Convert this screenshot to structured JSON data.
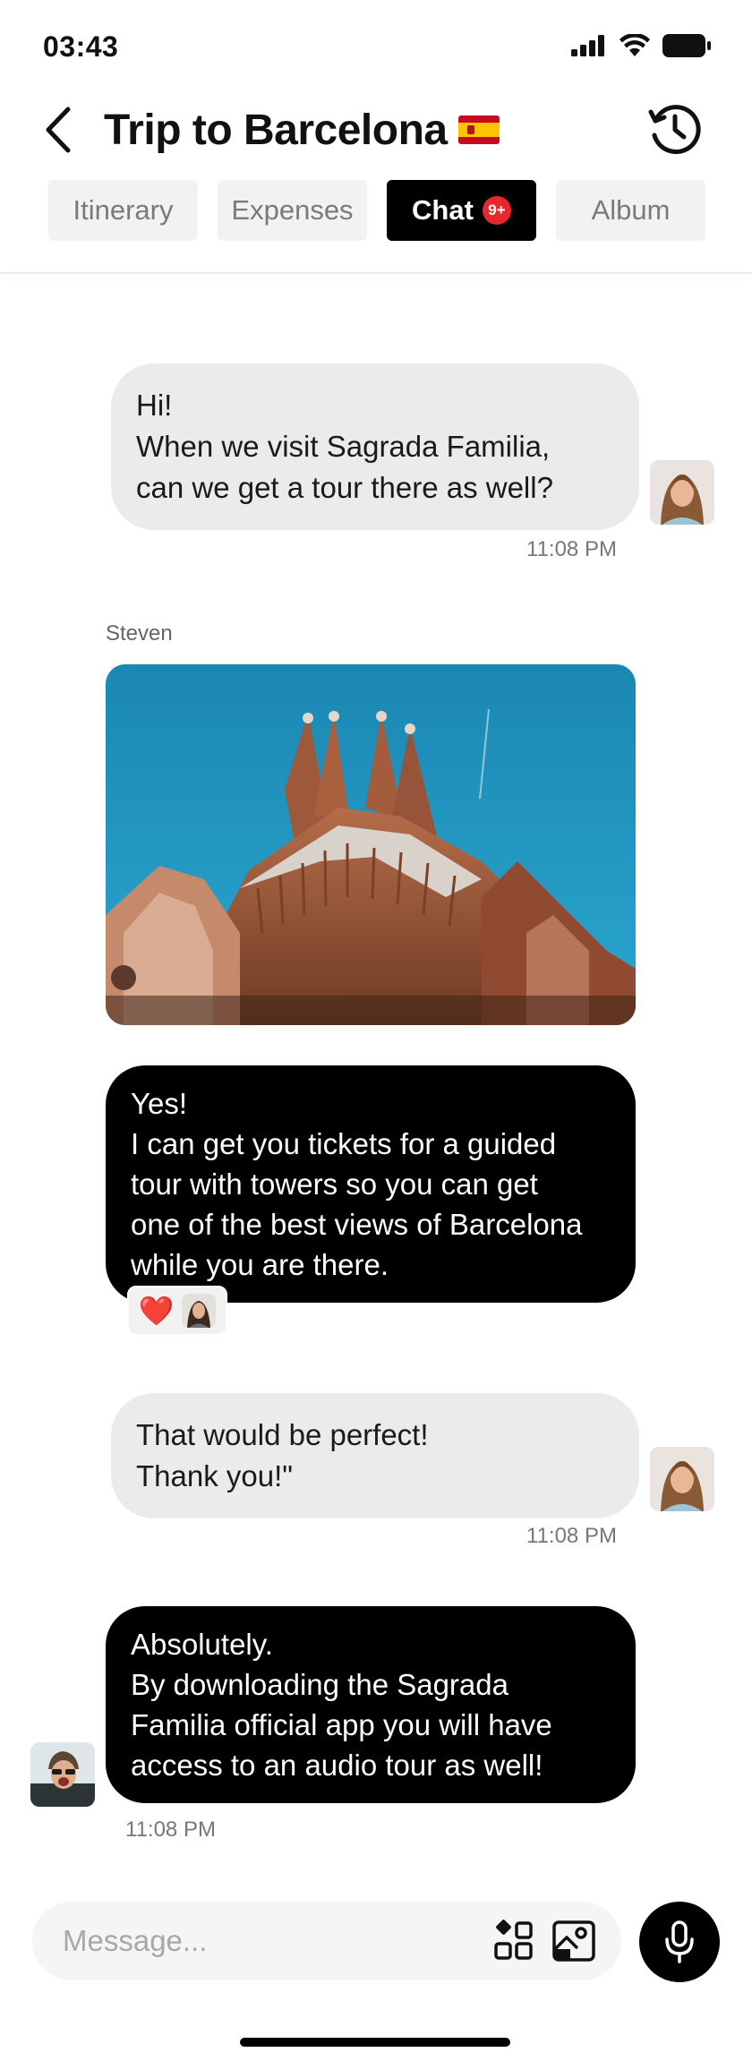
{
  "status_bar": {
    "time": "03:43"
  },
  "header": {
    "title": "Trip to Barcelona"
  },
  "tabs": [
    {
      "label": "Itinerary"
    },
    {
      "label": "Expenses"
    },
    {
      "label": "Chat",
      "badge": "9+"
    },
    {
      "label": "Album"
    }
  ],
  "messages": [
    {
      "direction": "outgoing",
      "lines": [
        "Hi!",
        "When we visit Sagrada Familia,",
        "can we get a tour there as well?"
      ],
      "time": "11:08 PM"
    },
    {
      "direction": "incoming",
      "sender": "Steven",
      "type": "image"
    },
    {
      "direction": "incoming",
      "lines": [
        "Yes!",
        "I can get you tickets for a guided",
        "tour with towers so you can get",
        "one of the best views of Barcelona",
        "while you are there."
      ],
      "reaction": "❤️"
    },
    {
      "direction": "outgoing",
      "lines": [
        "That would be perfect!",
        "Thank you!\""
      ],
      "time": "11:08 PM"
    },
    {
      "direction": "incoming",
      "lines": [
        "Absolutely.",
        "By downloading the Sagrada",
        "Familia official app you will have",
        "access to an audio tour as well!"
      ],
      "time": "11:08 PM"
    }
  ],
  "composer": {
    "placeholder": "Message..."
  },
  "colors": {
    "accent": "#000000",
    "badge": "#e8262d",
    "outgoing_bubble": "#ebebeb",
    "sky": "#1d8fb8"
  },
  "icons": [
    "back-arrow-icon",
    "history-icon",
    "apps-icon",
    "gallery-icon",
    "microphone-icon",
    "signal-icon",
    "wifi-icon",
    "battery-icon"
  ]
}
